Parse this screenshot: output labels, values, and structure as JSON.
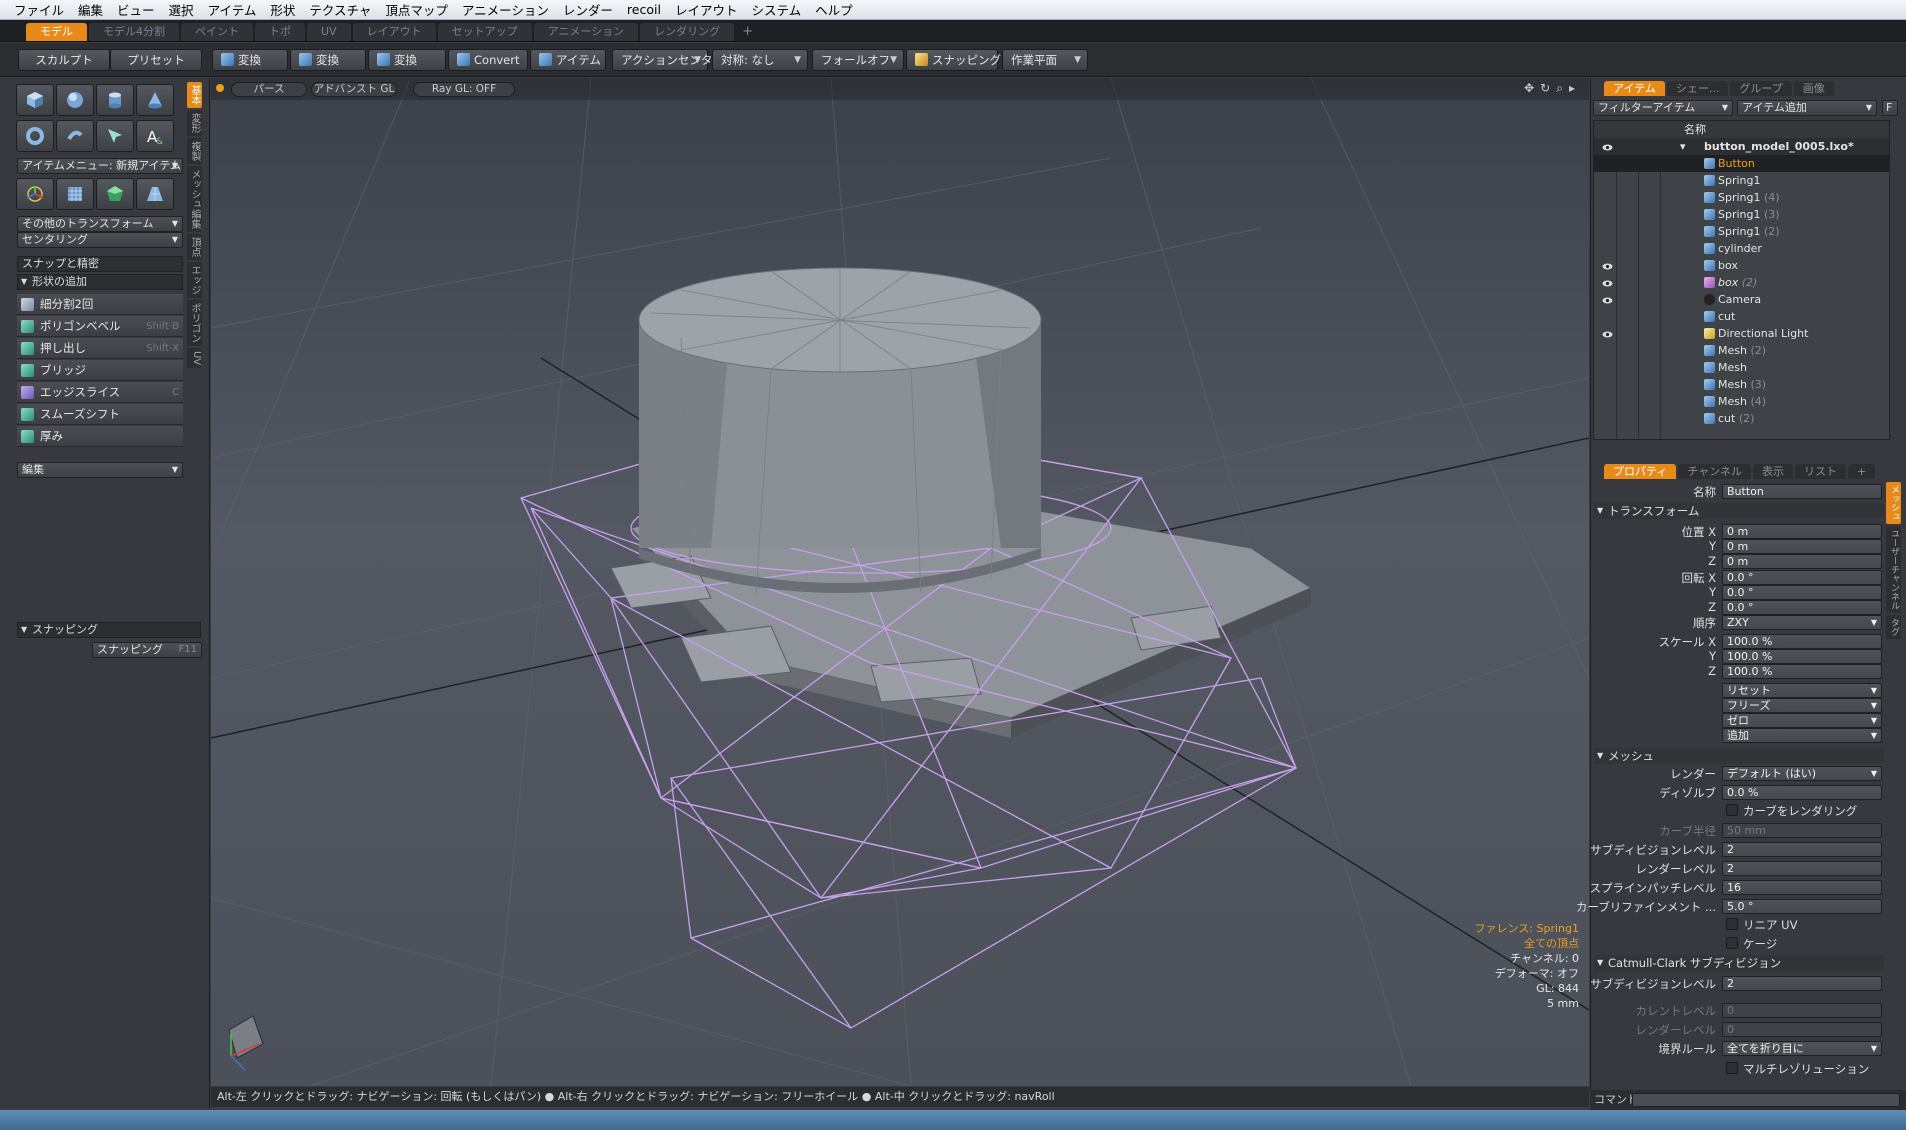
{
  "menubar": {
    "items": [
      "ファイル",
      "編集",
      "ビュー",
      "選択",
      "アイテム",
      "形状",
      "テクスチャ",
      "頂点マップ",
      "アニメーション",
      "レンダー",
      "recoil",
      "レイアウト",
      "システム",
      "ヘルプ"
    ]
  },
  "layout_tabs": {
    "items": [
      "モデル",
      "モデル4分割",
      "ペイント",
      "トポ",
      "UV",
      "レイアウト",
      "セットアップ",
      "アニメーション",
      "レンダリング"
    ],
    "plus": "+"
  },
  "toolbar": {
    "sculpt": "スカルプト",
    "preset": "プリセット",
    "transform1": "変換",
    "transform2": "変換",
    "transform3": "変換",
    "convert": "Convert",
    "item": "アイテム",
    "action_center": "アクションセンター",
    "symmetry": "対称: なし",
    "falloff": "フォールオフ",
    "snapping": "スナッピング",
    "work_plane": "作業平面"
  },
  "left_panel": {
    "item_menu": "アイテムメニュー: 新規アイテム",
    "other_transform": "その他のトランスフォーム",
    "centering": "センタリング",
    "snap_precision": "スナップと精密",
    "add_shape": "形状の追加",
    "tools": [
      {
        "label": "細分割2回",
        "shortcut": ""
      },
      {
        "label": "ポリゴンベベル",
        "shortcut": "Shift-B"
      },
      {
        "label": "押し出し",
        "shortcut": "Shift-X"
      },
      {
        "label": "ブリッジ",
        "shortcut": ""
      },
      {
        "label": "エッジスライス",
        "shortcut": "C"
      },
      {
        "label": "スムーズシフト",
        "shortcut": ""
      },
      {
        "label": "厚み",
        "shortcut": ""
      }
    ],
    "edit": "編集",
    "snapping_section": "スナッピング",
    "snapping_button": "スナッピング",
    "snapping_key": "F11",
    "vtabs": [
      "基本",
      "変形",
      "複製",
      "メッシュ編集",
      "頂点",
      "エッジ",
      "ポリゴン",
      "UV"
    ]
  },
  "viewport": {
    "buttons": [
      "パース",
      "アドバンスト GL",
      "Ray GL: OFF"
    ],
    "hud": {
      "line1": "ファレンス: Spring1",
      "line2": "全ての頂点",
      "line3": "チャンネル: 0",
      "line4": "デフォーマ: オフ",
      "line5": "GL: 844",
      "line6": "5 mm"
    },
    "accent": "#e8a020",
    "wire_color": "#c8a0ee"
  },
  "statusbar": {
    "text": "Alt-左 クリックとドラッグ: ナビゲーション: 回転 (もしくはパン) ● Alt-右 クリックとドラッグ: ナビゲーション: フリーホイール ● Alt-中 クリックとドラッグ: navRoll"
  },
  "item_list": {
    "tabs": [
      "アイテム",
      "シェー...",
      "グループ",
      "画像"
    ],
    "filter": "フィルターアイテム",
    "add_item": "アイテム追加",
    "f_button": "F",
    "header_name": "名称",
    "scene": "button_model_0005.lxo*",
    "items": [
      {
        "name": "Button",
        "suffix": ""
      },
      {
        "name": "Spring1",
        "suffix": ""
      },
      {
        "name": "Spring1",
        "suffix": "(4)"
      },
      {
        "name": "Spring1",
        "suffix": "(3)"
      },
      {
        "name": "Spring1",
        "suffix": "(2)"
      },
      {
        "name": "cylinder",
        "suffix": ""
      },
      {
        "name": "box",
        "suffix": ""
      },
      {
        "name": "box",
        "suffix": "(2)"
      },
      {
        "name": "Camera",
        "suffix": ""
      },
      {
        "name": "cut",
        "suffix": ""
      },
      {
        "name": "Directional Light",
        "suffix": ""
      },
      {
        "name": "Mesh",
        "suffix": "(2)"
      },
      {
        "name": "Mesh",
        "suffix": ""
      },
      {
        "name": "Mesh",
        "suffix": "(3)"
      },
      {
        "name": "Mesh",
        "suffix": "(4)"
      },
      {
        "name": "cut",
        "suffix": "(2)"
      }
    ]
  },
  "properties": {
    "tabs": [
      "プロパティ",
      "チャンネル",
      "表示",
      "リスト"
    ],
    "plus": "+",
    "side_tabs": [
      "メッシュ",
      "ユーザーチャンネル",
      "タグ"
    ],
    "name_label": "名称",
    "name_value": "Button",
    "transform_section": "トランスフォーム",
    "pos_x_label": "位置 X",
    "pos_x": "0 m",
    "pos_y_label": "Y",
    "pos_y": "0 m",
    "pos_z_label": "Z",
    "pos_z": "0 m",
    "rot_x_label": "回転 X",
    "rot_x": "0.0 °",
    "rot_y_label": "Y",
    "rot_y": "0.0 °",
    "rot_z_label": "Z",
    "rot_z": "0.0 °",
    "order_label": "順序",
    "order": "ZXY",
    "scale_x_label": "スケール X",
    "scale_x": "100.0 %",
    "scale_y_label": "Y",
    "scale_y": "100.0 %",
    "scale_z_label": "Z",
    "scale_z": "100.0 %",
    "reset": "リセット",
    "freeze": "フリーズ",
    "zero": "ゼロ",
    "add": "追加",
    "mesh_section": "メッシュ",
    "render_label": "レンダー",
    "render": "デフォルト (はい)",
    "dissolve_label": "ディゾルブ",
    "dissolve": "0.0 %",
    "render_curves": "カーブをレンダリング",
    "curve_radius_label": "カーブ半径",
    "curve_radius": "50 mm",
    "subdiv_label": "サブディビジョンレベル",
    "subdiv": "2",
    "render_level_label": "レンダーレベル",
    "render_level": "2",
    "spline_label": "スプラインパッチレベル",
    "spline": "16",
    "curve_refine_label": "カーブリファインメント ...",
    "curve_refine": "5.0 °",
    "linear_uv": "リニア UV",
    "cage": "ケージ",
    "catmull_section": "Catmull-Clark サブディビジョン",
    "cc_subdiv_label": "サブディビジョンレベル",
    "cc_subdiv": "2",
    "current_level_label": "カレントレベル",
    "current_level": "0",
    "cc_render_label": "レンダーレベル",
    "cc_render": "0",
    "boundary_label": "境界ルール",
    "boundary": "全てを折り目に",
    "multires": "マルチレゾリューション"
  },
  "command": {
    "label": "コマンド"
  }
}
